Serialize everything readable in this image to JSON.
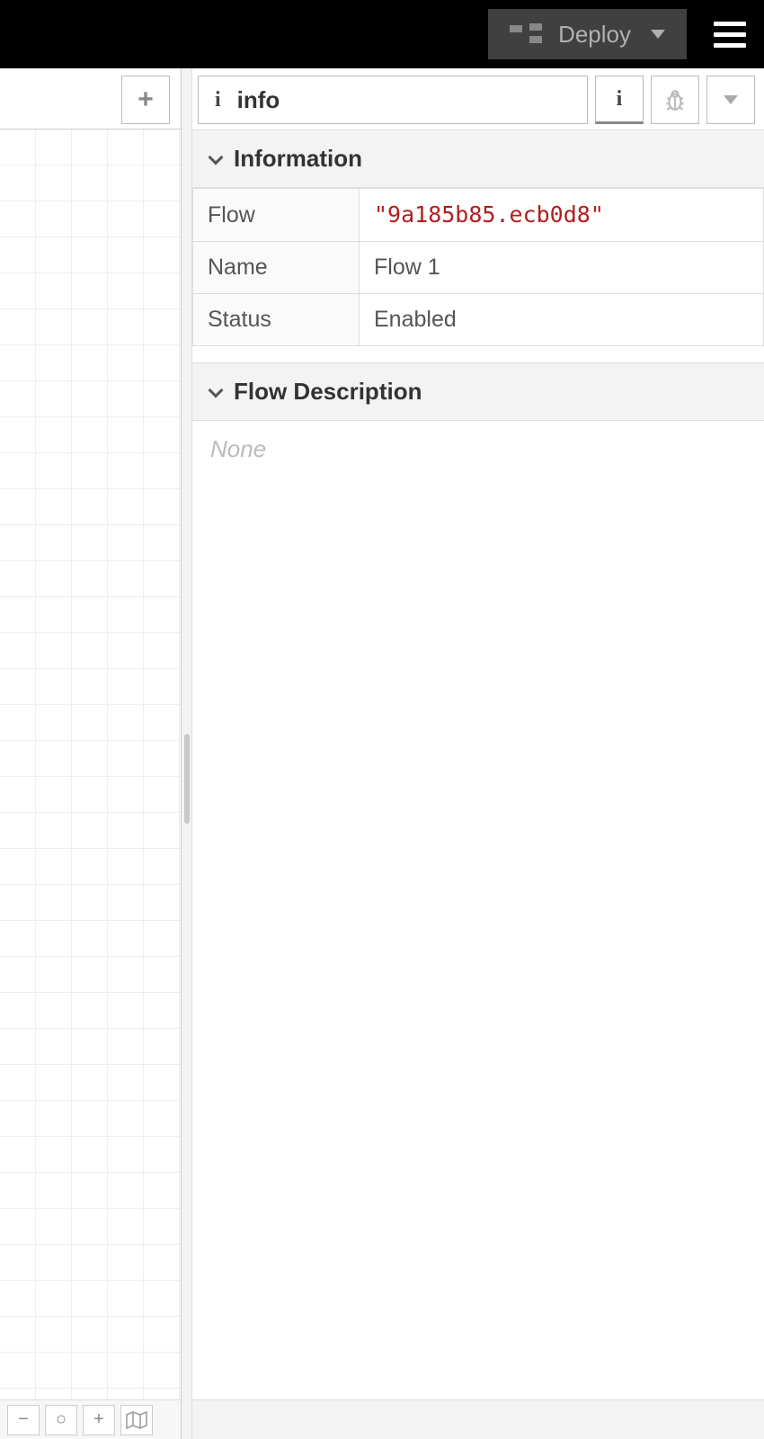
{
  "header": {
    "deploy_label": "Deploy"
  },
  "sidebar": {
    "tab_label": "info",
    "sections": {
      "information": {
        "title": "Information",
        "rows": {
          "flow": {
            "label": "Flow",
            "value": "\"9a185b85.ecb0d8\""
          },
          "name": {
            "label": "Name",
            "value": "Flow 1"
          },
          "status": {
            "label": "Status",
            "value": "Enabled"
          }
        }
      },
      "description": {
        "title": "Flow Description",
        "body": "None"
      }
    }
  },
  "canvas_footer": {
    "zoom_out": "−",
    "zoom_reset": "○",
    "zoom_in": "+"
  }
}
